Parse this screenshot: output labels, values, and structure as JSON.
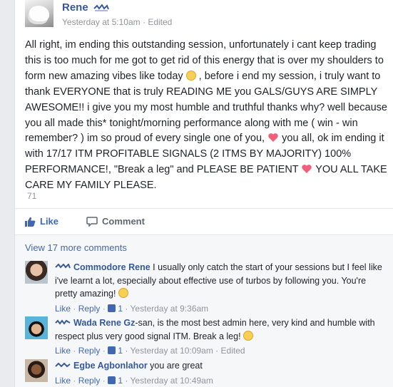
{
  "post": {
    "author": "Rene",
    "timestamp": "Yesterday at 5:10am",
    "edited": "Edited",
    "text_1": "All right, im ending this outstanding session, unfortunately i cant keep trading this is too much for me got to get rid of this energy that is over my shoulders to form new amazing vibes like today ",
    "text_2": " , before i end my session, i truly want to thank EVERYONE that is truly READING ME you GALS/GUYS ARE SIMPLY AWESOME!! i give you my most humble and truthful thanks why? well because you all made this* tonight/morning performance along with me ( win - win remember? ) im so proud of every single one of you, ",
    "text_3": " you all, ok im ending it with 17/17 ITM PROFITABLE SIGNALS (2 ITMS BY MAJORITY) 100% PERFORMANCE!, \"Break a leg\" and PLEASE BE PATIENT ",
    "text_4": " YOU ALL TAKE CARE MY FAMILY PLEASE.",
    "like_count": "71",
    "like_label": "Like",
    "comment_label": "Comment"
  },
  "comments_section": {
    "view_more": "View 17 more comments",
    "items": [
      {
        "name": "Commodore Rene",
        "text": " I usually only catch the start of your sessions but I feel like i've learnt a lot, especially about effective use of turbos by following you. You're pretty amazing! ",
        "like": "Like",
        "reply": "Reply",
        "likes": "1",
        "time": "Yesterday at 9:36am",
        "edited": ""
      },
      {
        "name": "Wada Rene Gz",
        "text": "-san, is the most best admin here, very kind and humble with respect plus very good signal ITM. Break a leg! ",
        "like": "Like",
        "reply": "Reply",
        "likes": "1",
        "time": "Yesterday at 10:09am",
        "edited": "Edited"
      },
      {
        "name": "Egbe Agbonlahor",
        "text": " you are great",
        "like": "Like",
        "reply": "Reply",
        "likes": "1",
        "time": "Yesterday at 10:49am",
        "edited": ""
      }
    ]
  },
  "colors": {
    "link": "#365899",
    "accent": "#4267b2",
    "meta": "#90949c",
    "heart": "#f0607a"
  }
}
